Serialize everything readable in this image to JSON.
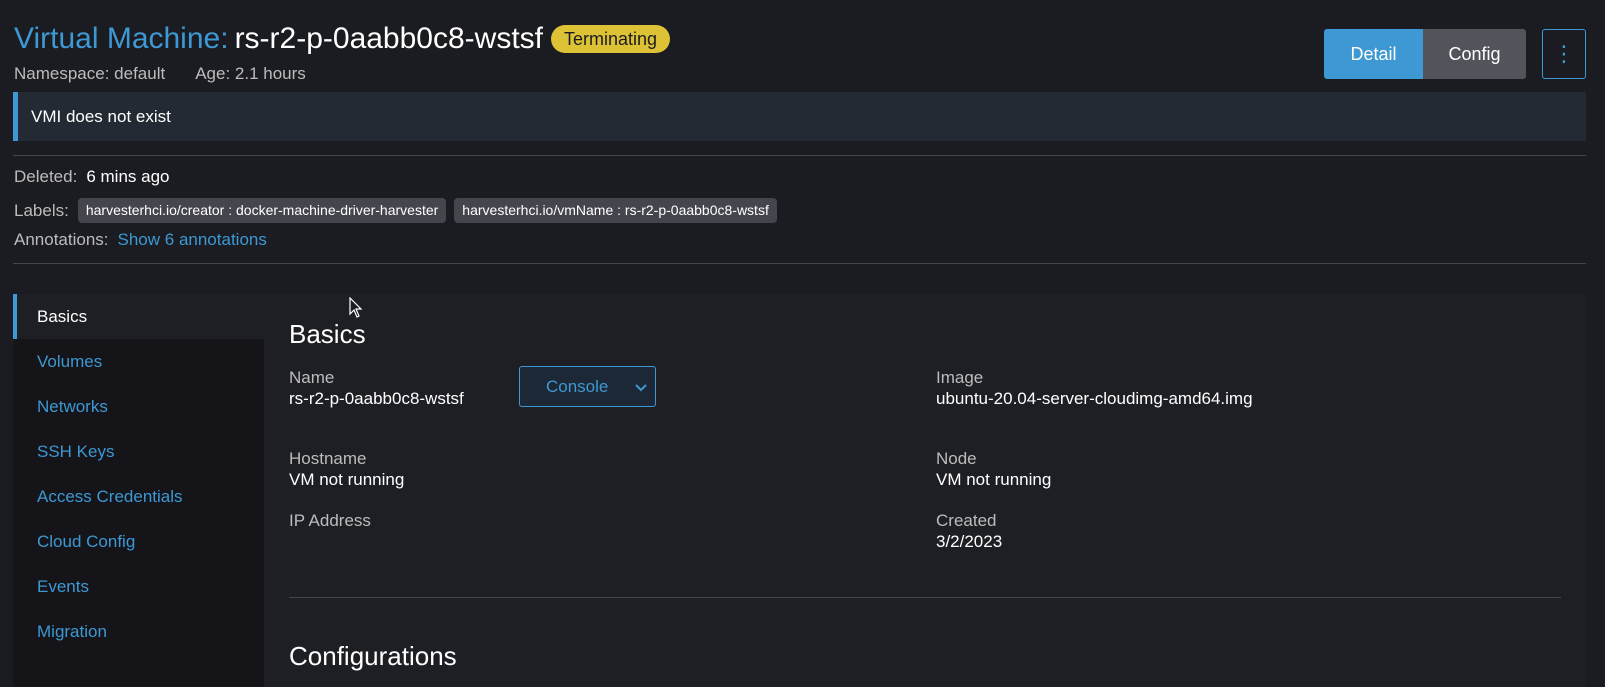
{
  "header": {
    "type_label": "Virtual Machine:",
    "name": "rs-r2-p-0aabb0c8-wstsf",
    "state": "Terminating",
    "namespace": "Namespace: default",
    "age": "Age: 2.1 hours"
  },
  "actions": {
    "detail_label": "Detail",
    "config_label": "Config",
    "more_icon": "⋮"
  },
  "banner": {
    "text": "VMI does not exist"
  },
  "meta": {
    "deleted_label": "Deleted:",
    "deleted_value": "6 mins ago",
    "labels_label": "Labels:",
    "labels": [
      "harvesterhci.io/creator : docker-machine-driver-harvester",
      "harvesterhci.io/vmName : rs-r2-p-0aabb0c8-wstsf"
    ],
    "annotations_label": "Annotations:",
    "annotations_link": "Show 6 annotations"
  },
  "sidenav": {
    "items": [
      "Basics",
      "Volumes",
      "Networks",
      "SSH Keys",
      "Access Credentials",
      "Cloud Config",
      "Events",
      "Migration"
    ],
    "active": "Basics"
  },
  "basics": {
    "title": "Basics",
    "name_label": "Name",
    "name_value": "rs-r2-p-0aabb0c8-wstsf",
    "console_label": "Console",
    "image_label": "Image",
    "image_value": "ubuntu-20.04-server-cloudimg-amd64.img",
    "hostname_label": "Hostname",
    "hostname_value": "VM not running",
    "node_label": "Node",
    "node_value": "VM not running",
    "ip_label": "IP Address",
    "created_label": "Created",
    "created_value": "3/2/2023"
  },
  "configurations": {
    "title": "Configurations"
  },
  "colors": {
    "accent": "#3d98d3",
    "badge": "#dcc234",
    "background": "#1b1c21"
  }
}
